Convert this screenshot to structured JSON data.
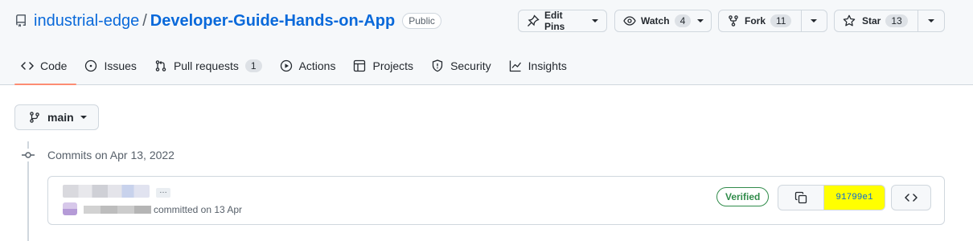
{
  "repo": {
    "owner": "industrial-edge",
    "separator": "/",
    "name": "Developer-Guide-Hands-on-App",
    "visibility": "Public"
  },
  "actions": {
    "edit_pins": "Edit Pins",
    "watch": "Watch",
    "watch_count": "4",
    "fork": "Fork",
    "fork_count": "11",
    "star": "Star",
    "star_count": "13"
  },
  "tabs": [
    {
      "label": "Code",
      "icon": "code-icon",
      "selected": true
    },
    {
      "label": "Issues",
      "icon": "issue-icon"
    },
    {
      "label": "Pull requests",
      "icon": "pull-request-icon",
      "count": "1"
    },
    {
      "label": "Actions",
      "icon": "play-icon"
    },
    {
      "label": "Projects",
      "icon": "table-icon"
    },
    {
      "label": "Security",
      "icon": "shield-icon"
    },
    {
      "label": "Insights",
      "icon": "graph-icon"
    }
  ],
  "branch": {
    "name": "main"
  },
  "commits": {
    "heading": "Commits on Apr 13, 2022",
    "items": [
      {
        "ellipsis": "…",
        "committed_text": "committed on 13 Apr",
        "verified": "Verified",
        "hash": "91799e1"
      }
    ]
  },
  "colors": {
    "accent": "#0969da",
    "selected_tab_underline": "#fd8c73",
    "verified": "#1a7f37",
    "hash_highlight": "#ffff00"
  }
}
